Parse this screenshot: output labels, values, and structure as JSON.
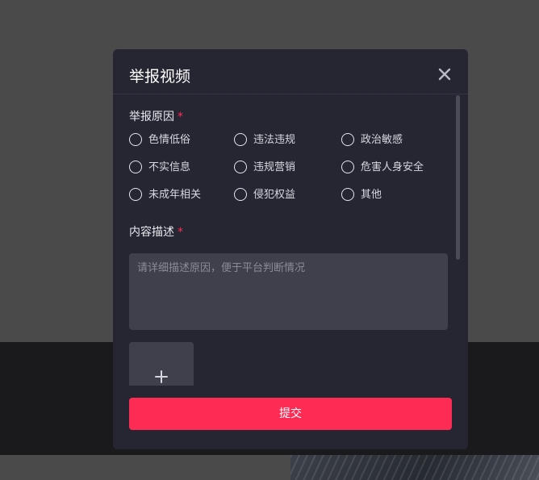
{
  "modal": {
    "title": "举报视频",
    "close_icon": "close-icon"
  },
  "reason": {
    "label": "举报原因",
    "required_mark": "*",
    "options": [
      "色情低俗",
      "违法违规",
      "政治敏感",
      "不实信息",
      "违规营销",
      "危害人身安全",
      "未成年相关",
      "侵犯权益",
      "其他"
    ]
  },
  "description": {
    "label": "内容描述",
    "required_mark": "*",
    "placeholder": "请详细描述原因，便于平台判断情况"
  },
  "upload": {
    "icon": "plus-icon"
  },
  "submit": {
    "label": "提交"
  },
  "colors": {
    "accent": "#fe2c55",
    "modal_bg": "#252632",
    "input_bg": "#3f404c"
  }
}
